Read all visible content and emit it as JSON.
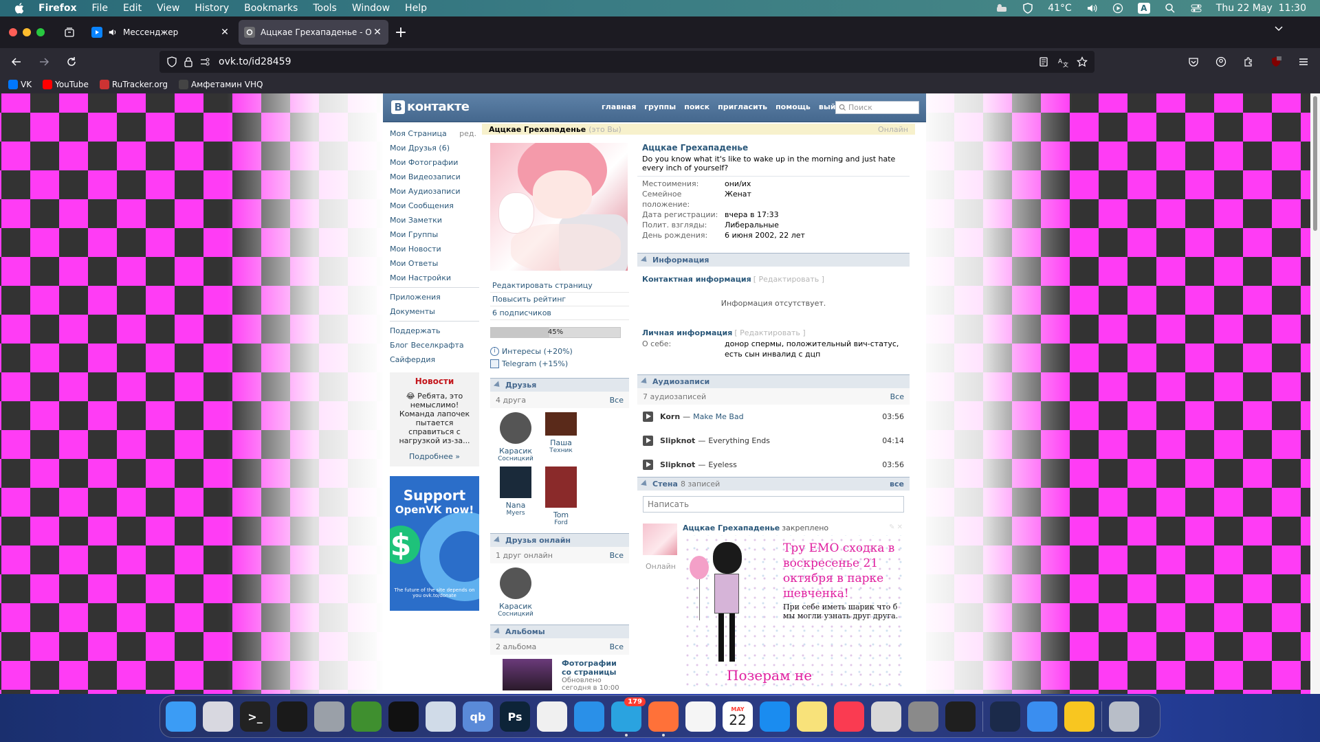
{
  "menubar": {
    "items": [
      "Firefox",
      "File",
      "Edit",
      "View",
      "History",
      "Bookmarks",
      "Tools",
      "Window",
      "Help"
    ],
    "temperature": "41°C",
    "input_source": "A",
    "datetime": "Thu 22 May  11:30"
  },
  "tabs": [
    {
      "title": "Мессенджер",
      "icon": "vk-video-icon"
    },
    {
      "title": "Аццкае Грехападенье - OpenVK",
      "icon": "openvk-icon"
    }
  ],
  "url": "ovk.to/id28459",
  "bookmarks": [
    {
      "label": "VK",
      "color": "#0077ff"
    },
    {
      "label": "YouTube",
      "color": "#ff0000"
    },
    {
      "label": "RuTracker.org",
      "color": "#cc3333"
    },
    {
      "label": "Амфетамин VHQ",
      "color": "#444444"
    }
  ],
  "site": {
    "logo_letter": "B",
    "logo_text": "контакте",
    "topnav": [
      "главная",
      "группы",
      "поиск",
      "пригласить",
      "помощь",
      "выйти"
    ],
    "search_placeholder": "Поиск"
  },
  "sidebar": {
    "items_main": [
      {
        "label": "Моя Страница",
        "edit": "ред."
      },
      {
        "label": "Мои Друзья (6)"
      },
      {
        "label": "Мои Фотографии"
      },
      {
        "label": "Мои Видеозаписи"
      },
      {
        "label": "Мои Аудиозаписи"
      },
      {
        "label": "Мои Сообщения"
      },
      {
        "label": "Мои Заметки"
      },
      {
        "label": "Мои Группы"
      },
      {
        "label": "Мои Новости"
      },
      {
        "label": "Мои Ответы"
      },
      {
        "label": "Мои Настройки"
      }
    ],
    "items_apps": [
      "Приложения",
      "Документы"
    ],
    "items_links": [
      "Поддержать",
      "Блог Веселкрафта",
      "Сайфердия"
    ],
    "news": {
      "title": "Новости",
      "text": "😂 Ребята, это немыслимо! Команда лапочек пытается справиться с нагрузкой из-за...",
      "more": "Подробнее »"
    },
    "donate": {
      "line1": "Support",
      "line2": "OpenVK now!",
      "coin": "$",
      "foot": "The future of the site depends on you ovk.to/donate"
    }
  },
  "profile": {
    "name": "Аццкае Грехападенье",
    "is_you": "(это Вы)",
    "online": "Онлайн",
    "status": "Do you know what it's like to wake up in the morning and just hate every inch of yourself?",
    "fields": [
      {
        "k": "Местоимения:",
        "v": "они/их"
      },
      {
        "k": "Семейное положение:",
        "v": "Женат"
      },
      {
        "k": "Дата регистрации:",
        "v": "вчера в 17:33"
      },
      {
        "k": "Полит. взгляды:",
        "v": "Либеральные"
      },
      {
        "k": "День рождения:",
        "v": "6 июня 2002, 22 лет"
      }
    ],
    "actions": [
      "Редактировать страницу",
      "Повысить рейтинг",
      "6 подписчиков"
    ],
    "rating_percent": 45,
    "rating_label": "45%",
    "bonuses": [
      "Интересы (+20%)",
      "Telegram (+15%)"
    ]
  },
  "friends": {
    "title": "Друзья",
    "count": "4 друга",
    "all": "Все",
    "list": [
      {
        "first": "Карасик",
        "last": "Сосницкий",
        "color": "#4a4a4a"
      },
      {
        "first": "Паша",
        "last": "Техник",
        "color": "#5a2a1a"
      },
      {
        "first": "Nana",
        "last": "Myers",
        "color": "#1a2a3a"
      },
      {
        "first": "Tom",
        "last": "Ford",
        "color": "#8a2a2a"
      }
    ]
  },
  "friends_online": {
    "title": "Друзья онлайн",
    "count": "1 друг онлайн",
    "all": "Все",
    "list": [
      {
        "first": "Карасик",
        "last": "Сосницкий",
        "color": "#4a4a4a"
      }
    ]
  },
  "albums": {
    "title": "Альбомы",
    "count": "2 альбома",
    "all": "Все",
    "first_title": "Фотографии со страницы",
    "first_sub": "Обновлено сегодня в 10:00"
  },
  "info": {
    "title": "Информация",
    "contact_title": "Контактная информация",
    "contact_edit": "[ Редактировать ]",
    "contact_empty": "Информация отсутствует.",
    "personal_title": "Личная информация",
    "personal_edit": "[ Редактировать ]",
    "about_k": "О себе:",
    "about_v": "донор спермы, положительный вич-статус, есть сын инвалид с дцп"
  },
  "audio": {
    "title": "Аудиозаписи",
    "count": "7 аудиозаписей",
    "all": "Все",
    "tracks": [
      {
        "artist": "Korn",
        "title": "Make Me Bad",
        "dur": "03:56"
      },
      {
        "artist": "Slipknot",
        "title": "Everything Ends",
        "dur": "04:14"
      },
      {
        "artist": "Slipknot",
        "title": "Eyeless",
        "dur": "03:56"
      }
    ]
  },
  "wall": {
    "title": "Стена",
    "count": "8 записей",
    "all": "все",
    "placeholder": "Написать",
    "post_author": "Аццкае Грехападенье",
    "post_pinned": "закреплено",
    "post_online": "Онлайн",
    "img_text1": "Тру ЕМО сходка в воскресенье 21 октября в парке шевченка!",
    "img_text2": "При себе иметь шарик что б мы могли узнать друг друга.",
    "img_text3": "Позерам не приходить!!!"
  },
  "dock": [
    {
      "name": "finder-icon",
      "color": "#3b9cf5",
      "label": ""
    },
    {
      "name": "launchpad-icon",
      "color": "#d8d8e0",
      "label": ""
    },
    {
      "name": "terminal-icon",
      "color": "#222222",
      "label": ">_"
    },
    {
      "name": "activity-monitor-icon",
      "color": "#1a1a1a",
      "label": ""
    },
    {
      "name": "disk-utility-icon",
      "color": "#9aa0a8",
      "label": ""
    },
    {
      "name": "minecraft-icon",
      "color": "#3f8f2f",
      "label": ""
    },
    {
      "name": "pwa-icon",
      "color": "#111111",
      "label": ""
    },
    {
      "name": "app-icon",
      "color": "#d0dbe8",
      "label": ""
    },
    {
      "name": "qbittorrent-icon",
      "color": "#5a8ad8",
      "label": "qb"
    },
    {
      "name": "photoshop-icon",
      "color": "#0d2438",
      "label": "Ps"
    },
    {
      "name": "capcut-icon",
      "color": "#f0f0f0",
      "label": ""
    },
    {
      "name": "safari-icon",
      "color": "#2a90e8",
      "label": ""
    },
    {
      "name": "telegram-icon",
      "color": "#2aa3e0",
      "label": "",
      "badge": "179",
      "dot": true
    },
    {
      "name": "firefox-icon",
      "color": "#ff7139",
      "label": "",
      "dot": true
    },
    {
      "name": "photos-icon",
      "color": "#f5f5f5",
      "label": ""
    },
    {
      "name": "calendar-icon",
      "color": "#ffffff",
      "label": "22",
      "month": "MAY"
    },
    {
      "name": "app-store-icon",
      "color": "#1a8cf0",
      "label": ""
    },
    {
      "name": "notes-icon",
      "color": "#f8e27a",
      "label": ""
    },
    {
      "name": "music-icon",
      "color": "#fa3b51",
      "label": ""
    },
    {
      "name": "preview-icon",
      "color": "#d8d8d8",
      "label": ""
    },
    {
      "name": "system-settings-icon",
      "color": "#8a8a8a",
      "label": ""
    },
    {
      "name": "notion-icon",
      "color": "#1f1f1f",
      "label": ""
    },
    {
      "name": "screen-time-icon",
      "color": "#1b2a4a",
      "label": ""
    },
    {
      "name": "mail-icon",
      "color": "#3a8ef0",
      "label": ""
    },
    {
      "name": "tips-icon",
      "color": "#f8c620",
      "label": ""
    },
    {
      "name": "trash-icon",
      "color": "#b8bec8",
      "label": ""
    }
  ]
}
